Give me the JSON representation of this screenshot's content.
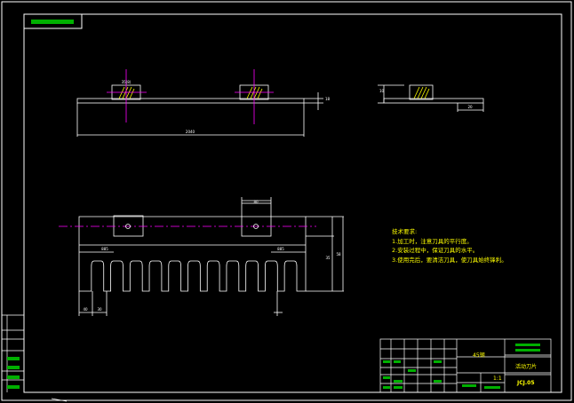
{
  "drawing": {
    "notes_title": "技术要求:",
    "notes": [
      "1.加工时，注意刀具的平行度。",
      "2.安装过程中，保证刀具的水平。",
      "3.使用完后，要清洁刀具，使刀具始终锋利。"
    ],
    "dims": {
      "top_overall": "2040",
      "top_block": "35(8)",
      "top_right_side": "18",
      "side_width": "20",
      "side_height": "10",
      "front_block_width": "80",
      "front_left_offset": "885",
      "front_right_offset": "885",
      "front_height": "58",
      "front_tooth_height": "35",
      "front_bottom_a": "40",
      "front_bottom_b": "30"
    },
    "title_block": {
      "material": "45钢",
      "part_name": "活动刀片",
      "scale": "1:1",
      "drawing_no": "JCJ.05"
    },
    "colors": {
      "background": "#000000",
      "outline": "#ffffff",
      "centerline": "#ff00ff",
      "dimension": "#ffffff",
      "text": "#ffff00",
      "hatch": "#ffff00",
      "label_block": "#00b000"
    }
  }
}
